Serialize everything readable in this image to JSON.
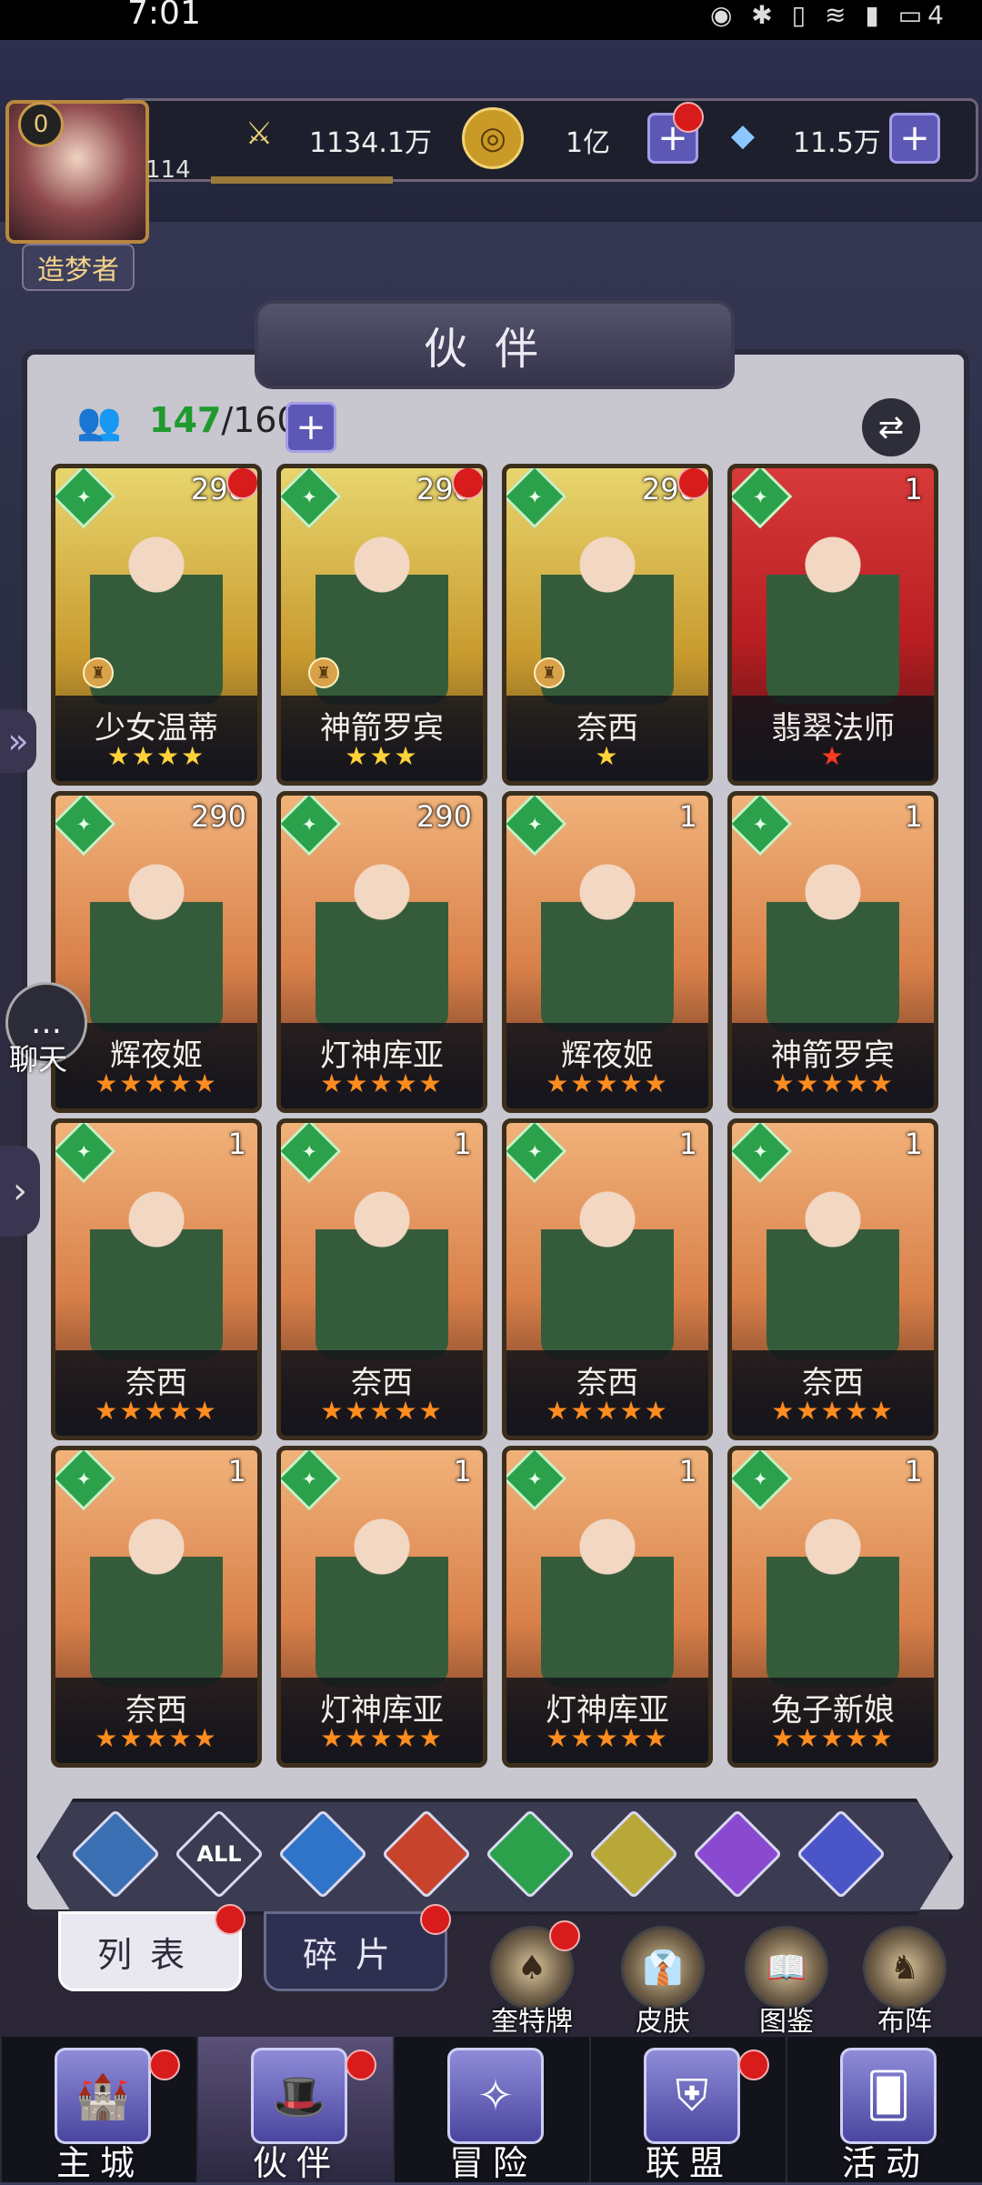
{
  "status_bar": {
    "time": "7:01",
    "battery": "4"
  },
  "player": {
    "level_badge": "0",
    "level": "114",
    "title": "造梦者"
  },
  "resources": [
    {
      "icon": "sword-icon",
      "value": "1134.1万"
    },
    {
      "icon": "gold-coin-icon",
      "value": "1亿"
    },
    {
      "icon": "diamond-icon",
      "value": "11.5万"
    }
  ],
  "panel": {
    "title": "伙伴",
    "count_current": "147",
    "count_total": "/160"
  },
  "cards": [
    {
      "name": "少女温蒂",
      "level": "290",
      "stars": 4,
      "frame": "gold",
      "star_color": "yellow",
      "red_dot": true,
      "badge": true
    },
    {
      "name": "神箭罗宾",
      "level": "290",
      "stars": 3,
      "frame": "gold",
      "star_color": "yellow",
      "red_dot": true,
      "badge": true
    },
    {
      "name": "奈西",
      "level": "290",
      "stars": 1,
      "frame": "gold",
      "star_color": "yellow",
      "red_dot": true,
      "badge": true
    },
    {
      "name": "翡翠法师",
      "level": "1",
      "stars": 1,
      "frame": "red",
      "star_color": "red",
      "red_dot": false,
      "badge": false
    },
    {
      "name": "辉夜姬",
      "level": "290",
      "stars": 5,
      "frame": "orange",
      "star_color": "orange",
      "red_dot": false,
      "badge": false
    },
    {
      "name": "灯神库亚",
      "level": "290",
      "stars": 5,
      "frame": "orange",
      "star_color": "orange",
      "red_dot": false,
      "badge": false
    },
    {
      "name": "辉夜姬",
      "level": "1",
      "stars": 5,
      "frame": "orange",
      "star_color": "orange",
      "red_dot": false,
      "badge": false
    },
    {
      "name": "神箭罗宾",
      "level": "1",
      "stars": 5,
      "frame": "orange",
      "star_color": "orange",
      "red_dot": false,
      "badge": false
    },
    {
      "name": "奈西",
      "level": "1",
      "stars": 5,
      "frame": "orange",
      "star_color": "orange",
      "red_dot": false,
      "badge": false
    },
    {
      "name": "奈西",
      "level": "1",
      "stars": 5,
      "frame": "orange",
      "star_color": "orange",
      "red_dot": false,
      "badge": false
    },
    {
      "name": "奈西",
      "level": "1",
      "stars": 5,
      "frame": "orange",
      "star_color": "orange",
      "red_dot": false,
      "badge": false
    },
    {
      "name": "奈西",
      "level": "1",
      "stars": 5,
      "frame": "orange",
      "star_color": "orange",
      "red_dot": false,
      "badge": false
    },
    {
      "name": "奈西",
      "level": "1",
      "stars": 5,
      "frame": "orange",
      "star_color": "orange",
      "red_dot": false,
      "badge": false
    },
    {
      "name": "灯神库亚",
      "level": "1",
      "stars": 5,
      "frame": "orange",
      "star_color": "orange",
      "red_dot": false,
      "badge": false
    },
    {
      "name": "灯神库亚",
      "level": "1",
      "stars": 5,
      "frame": "orange",
      "star_color": "orange",
      "red_dot": false,
      "badge": false
    },
    {
      "name": "兔子新娘",
      "level": "1",
      "stars": 5,
      "frame": "orange",
      "star_color": "orange",
      "red_dot": false,
      "badge": false
    }
  ],
  "side": {
    "chat_label": "聊天"
  },
  "filters": [
    {
      "icon": "light-icon",
      "label": "",
      "color": "#3a6fb4"
    },
    {
      "icon": "all-icon",
      "label": "ALL",
      "color": "#3b3b52"
    },
    {
      "icon": "water-icon",
      "label": "",
      "color": "#2f74c8"
    },
    {
      "icon": "fire-icon",
      "label": "",
      "color": "#c8432c"
    },
    {
      "icon": "wind-icon",
      "label": "",
      "color": "#2aa14a"
    },
    {
      "icon": "holy-icon",
      "label": "",
      "color": "#b8a83a"
    },
    {
      "icon": "moon-icon",
      "label": "",
      "color": "#8a4ad0"
    },
    {
      "icon": "planet-icon",
      "label": "",
      "color": "#4a56c8"
    }
  ],
  "sub_tabs": {
    "list": "列表",
    "fragments": "碎片"
  },
  "shortcuts": [
    {
      "label": "奎特牌",
      "icon": "card-pack-icon",
      "red_dot": true
    },
    {
      "label": "皮肤",
      "icon": "outfit-icon",
      "red_dot": false
    },
    {
      "label": "图鉴",
      "icon": "collection-book-icon",
      "red_dot": false
    },
    {
      "label": "布阵",
      "icon": "formation-icon",
      "red_dot": false
    }
  ],
  "bottom_nav": [
    {
      "label": "主城",
      "icon": "castle-icon",
      "red_dot": true,
      "active": false
    },
    {
      "label": "伙伴",
      "icon": "wizard-hat-icon",
      "red_dot": true,
      "active": true
    },
    {
      "label": "冒险",
      "icon": "compass-icon",
      "red_dot": false,
      "active": false
    },
    {
      "label": "联盟",
      "icon": "shield-icon",
      "red_dot": true,
      "active": false
    },
    {
      "label": "活动",
      "icon": "cards-icon",
      "red_dot": false,
      "active": false
    }
  ],
  "colors": {
    "accent": "#5d57b5",
    "red_dot": "#d81b1b",
    "count_green": "#1f9a2e"
  }
}
